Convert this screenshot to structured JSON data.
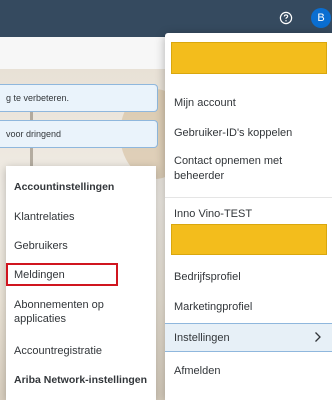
{
  "topbar": {
    "help_icon": "help-circle-icon",
    "avatar_letter": "B",
    "colors": {
      "bar": "#354a5f",
      "avatar": "#0a6ed1"
    }
  },
  "background": {
    "notices": [
      {
        "text": "g te verbeteren."
      },
      {
        "text": "voor dringend"
      }
    ]
  },
  "settings_submenu": {
    "items": [
      {
        "label": "Accountinstellingen",
        "type": "header"
      },
      {
        "label": "Klantrelaties",
        "type": "link"
      },
      {
        "label": "Gebruikers",
        "type": "link"
      },
      {
        "label": "Meldingen",
        "type": "link",
        "highlighted": true
      },
      {
        "label": "Abonnementen op applicaties",
        "type": "link"
      },
      {
        "label": "Accountregistratie",
        "type": "link"
      },
      {
        "label": "Ariba Network-instellingen",
        "type": "header"
      }
    ]
  },
  "user_menu": {
    "items": [
      {
        "label": "Mijn account"
      },
      {
        "label": "Gebruiker-ID's koppelen"
      },
      {
        "label": "Contact opnemen met beheerder"
      },
      {
        "label": "Inno Vino-TEST"
      },
      {
        "label": "Bedrijfsprofiel"
      },
      {
        "label": "Marketingprofiel"
      },
      {
        "label": "Instellingen",
        "selected": true,
        "submenu_icon": "chevron-right-icon"
      },
      {
        "label": "Afmelden"
      }
    ],
    "redaction_color": "#f3bd1c"
  }
}
